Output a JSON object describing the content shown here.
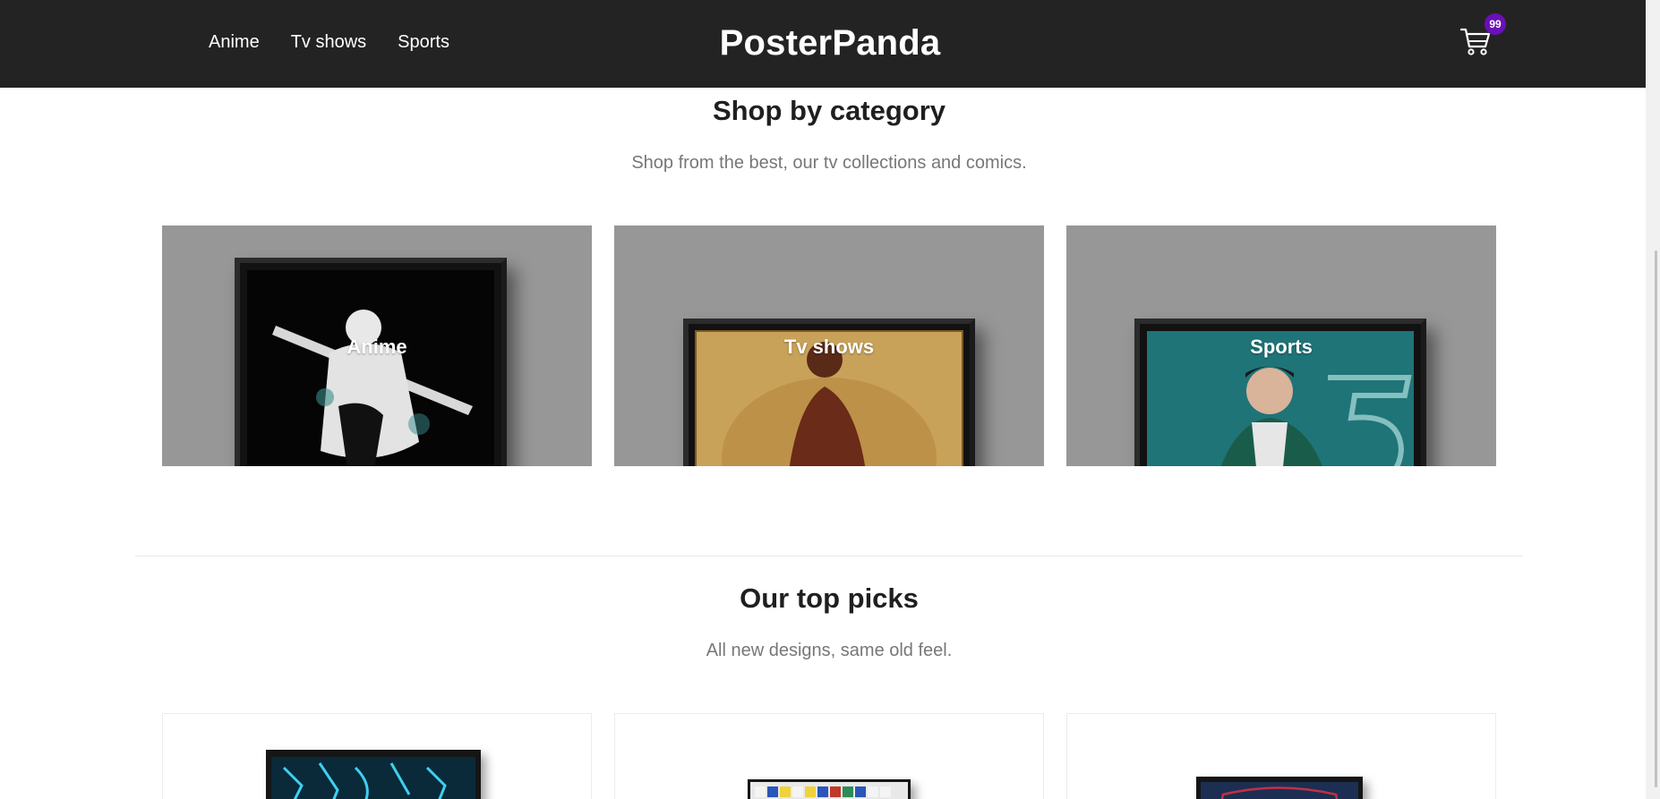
{
  "nav": {
    "links": [
      "Anime",
      "Tv shows",
      "Sports"
    ],
    "brand": "PosterPanda",
    "cart_count": "99"
  },
  "categories_section": {
    "title": "Shop by category",
    "subtitle": "Shop from the best, our tv collections and comics.",
    "cards": [
      {
        "label": "Anime"
      },
      {
        "label": "Tv shows"
      },
      {
        "label": "Sports"
      }
    ]
  },
  "top_picks_section": {
    "title": "Our top picks",
    "subtitle": "All new designs, same old feel."
  },
  "colors": {
    "navbar_bg": "#232323",
    "card_overlay": "#979797",
    "badge": "#6b0fb8",
    "muted_text": "#777777"
  },
  "icons": {
    "cart": "shopping-cart-icon"
  }
}
